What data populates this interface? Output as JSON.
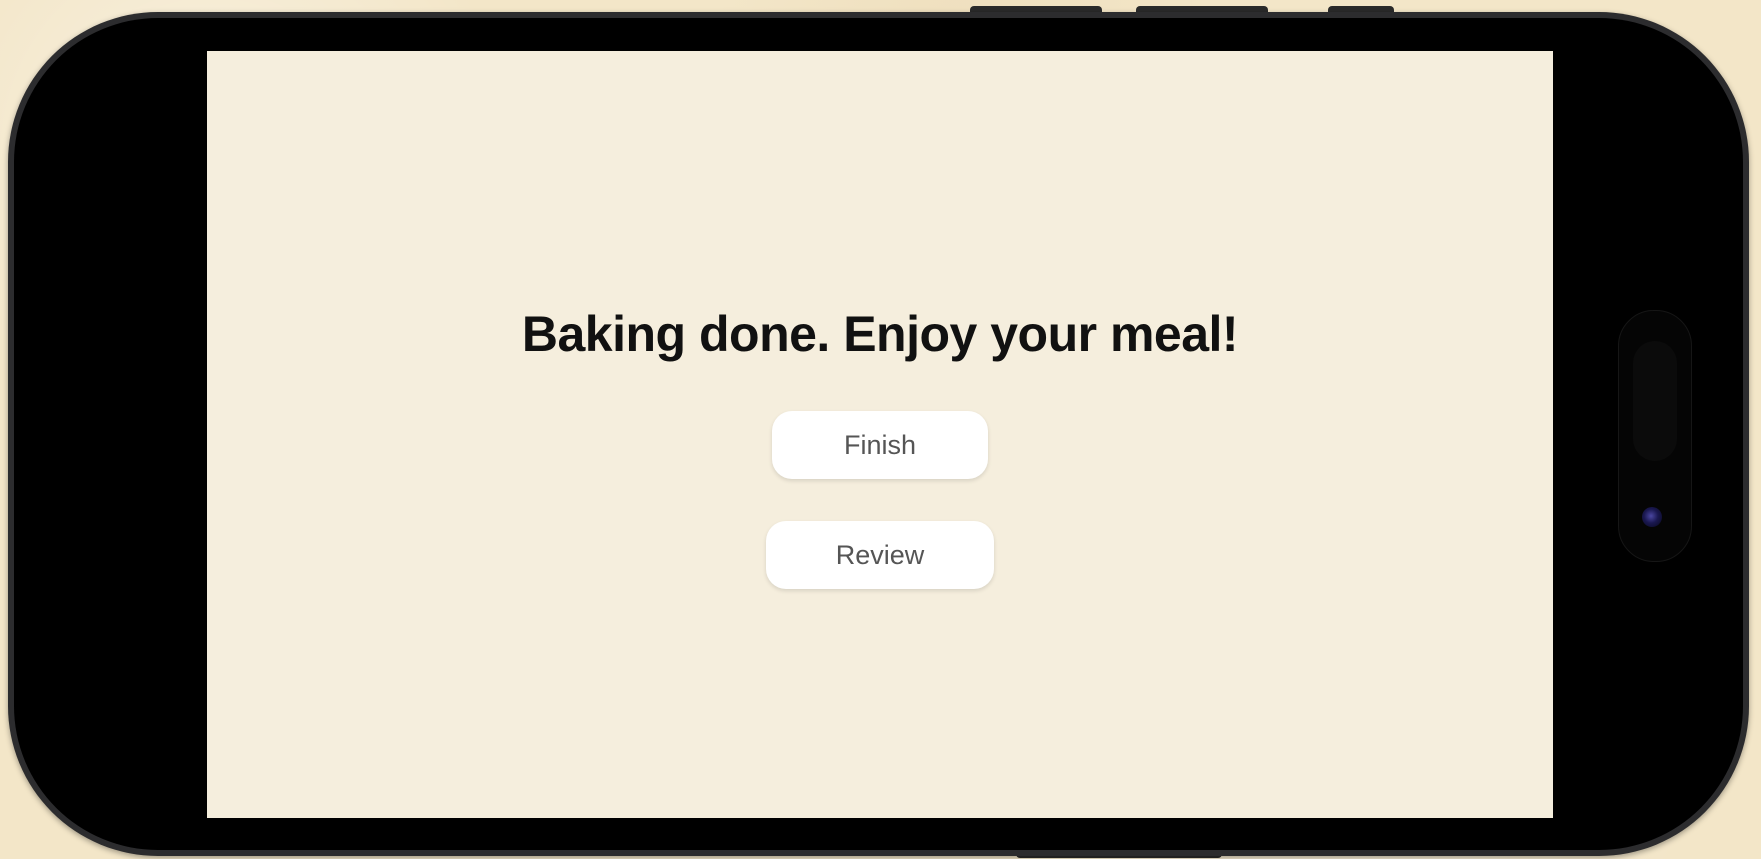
{
  "screen": {
    "message": "Baking done. Enjoy your meal!",
    "buttons": {
      "finish_label": "Finish",
      "review_label": "Review"
    }
  },
  "colors": {
    "backdrop": "#f3e6c8",
    "screen_background": "#f5eedd",
    "button_background": "#ffffff",
    "button_text": "#555555",
    "heading_text": "#111111"
  },
  "device": {
    "orientation": "landscape",
    "icons": [
      "dynamic-island",
      "front-camera-icon"
    ]
  }
}
